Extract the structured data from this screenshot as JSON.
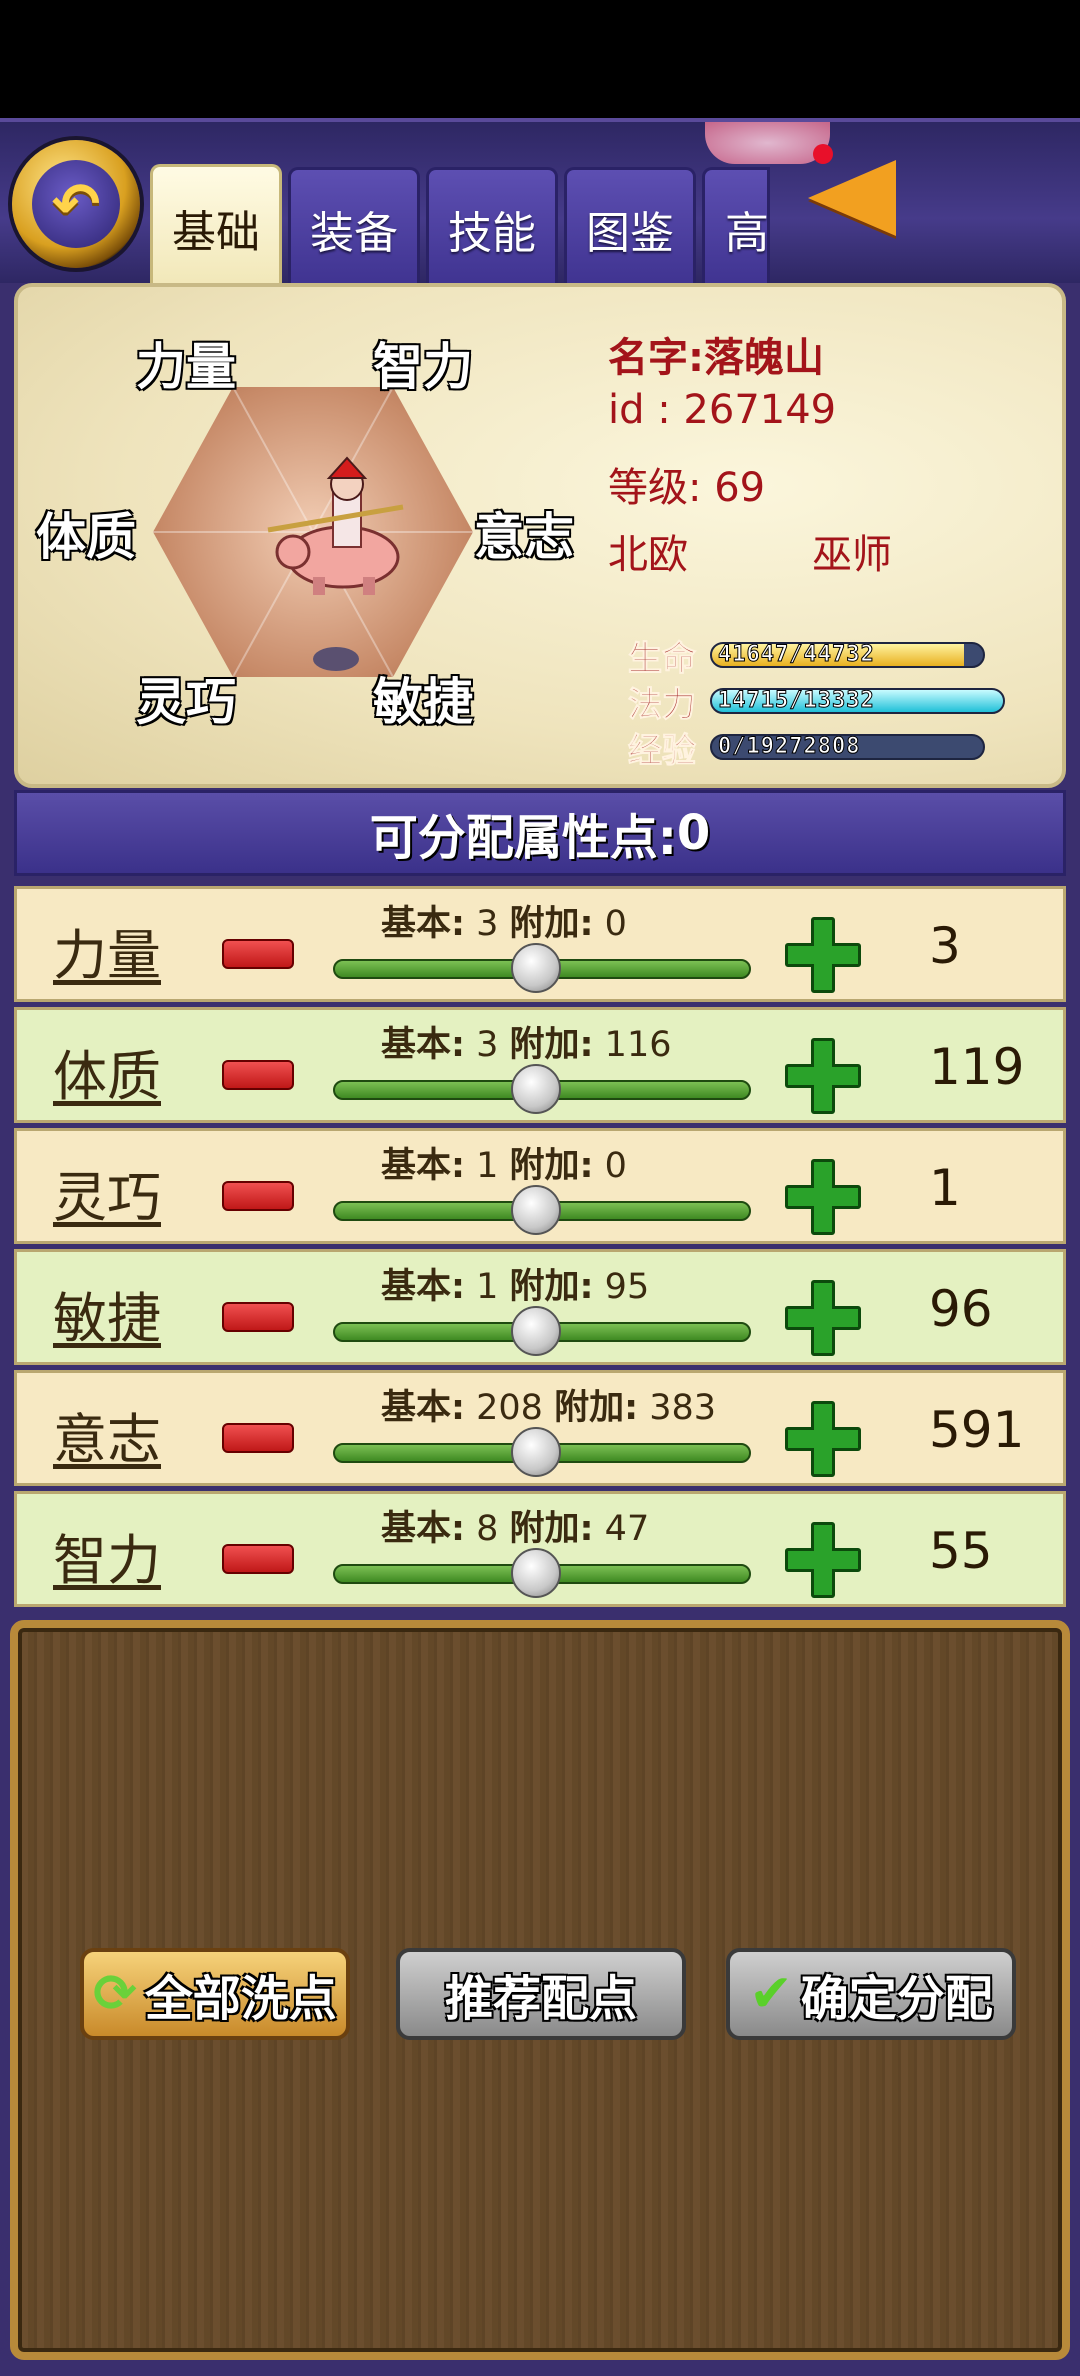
{
  "tabs": [
    "基础",
    "装备",
    "技能",
    "图鉴",
    "高"
  ],
  "hex_labels": [
    "力量",
    "智力",
    "体质",
    "意志",
    "灵巧",
    "敏捷"
  ],
  "character": {
    "name_label": "名字:",
    "name": "落魄山",
    "id_label": "id : ",
    "id": "267149",
    "level_label": "等级: ",
    "level": "69",
    "region": "北欧",
    "class": "巫师"
  },
  "bars": [
    {
      "label": "生命",
      "text": "41647/44732",
      "fill_fraction": 0.93
    },
    {
      "label": "法力",
      "text": "14715/13332",
      "fill_fraction": 1.0
    },
    {
      "label": "经验",
      "text": "0/19272808",
      "fill_fraction": 0.0
    }
  ],
  "points": {
    "label": "可分配属性点:",
    "value": "0"
  },
  "labels": {
    "base": "基本:",
    "bonus": "附加:"
  },
  "stats": [
    {
      "name": "力量",
      "base": " 3",
      "bonus": " 0",
      "total": "3"
    },
    {
      "name": "体质",
      "base": " 3",
      "bonus": " 116",
      "total": "119"
    },
    {
      "name": "灵巧",
      "base": " 1",
      "bonus": " 0",
      "total": "1"
    },
    {
      "name": "敏捷",
      "base": " 1",
      "bonus": " 95",
      "total": "96"
    },
    {
      "name": "意志",
      "base": " 208",
      "bonus": " 383",
      "total": "591"
    },
    {
      "name": "智力",
      "base": " 8",
      "bonus": " 47",
      "total": "55"
    }
  ],
  "buttons": {
    "reset": "全部洗点",
    "recommend": "推荐配点",
    "confirm": "确定分配"
  },
  "colors": {
    "name_red": "#a3141a",
    "tab_purple": "#4a3e9c",
    "row_cream": "#f7e9c3",
    "row_green": "#e4f1c1"
  }
}
